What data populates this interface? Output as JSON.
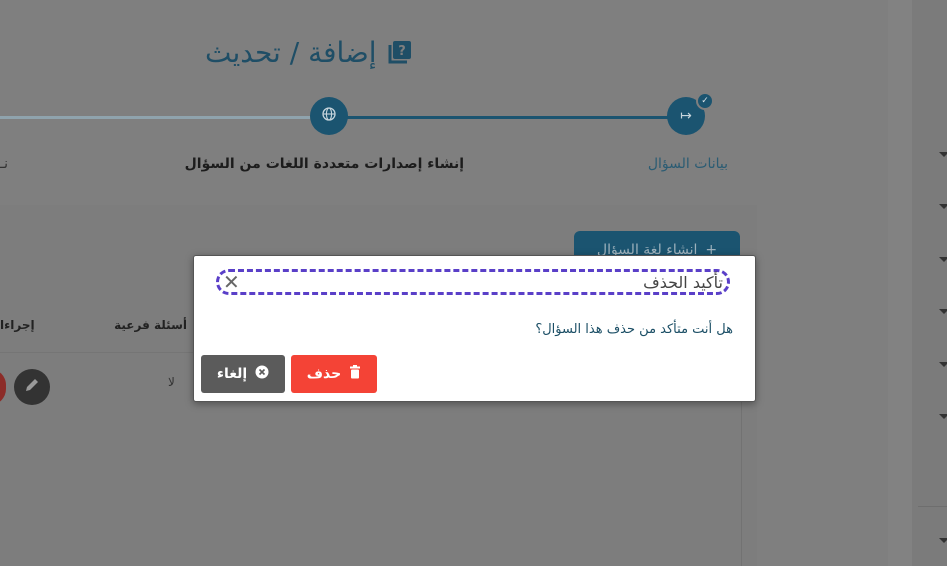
{
  "page": {
    "title": "إضافة / تحديث",
    "title_icon": "question-book-icon"
  },
  "stepper": {
    "steps": [
      {
        "label": "بيانات السؤال",
        "icon": "arrow-right-icon",
        "completed": true
      },
      {
        "label": "إنشاء إصدارات متعددة اللغات من السؤال",
        "icon": "globe-icon",
        "completed": false
      },
      {
        "label": "نـ",
        "icon": "",
        "completed": false
      }
    ]
  },
  "toolbar": {
    "add_language_label": "انشاء لغة السؤال"
  },
  "table": {
    "headers": [
      "أسئلة فرعية",
      "إجراءا"
    ],
    "rows": [
      {
        "sub_questions": "لا"
      }
    ]
  },
  "modal": {
    "title": "تأكيد الحذف",
    "message": "هل أنت متأكد من حذف هذا السؤال؟",
    "delete_label": "حذف",
    "cancel_label": "إلغاء"
  },
  "colors": {
    "primary": "#1b5470",
    "danger": "#f44336",
    "cancel": "#5b5b5b",
    "focus_outline": "#5a3fc8"
  }
}
